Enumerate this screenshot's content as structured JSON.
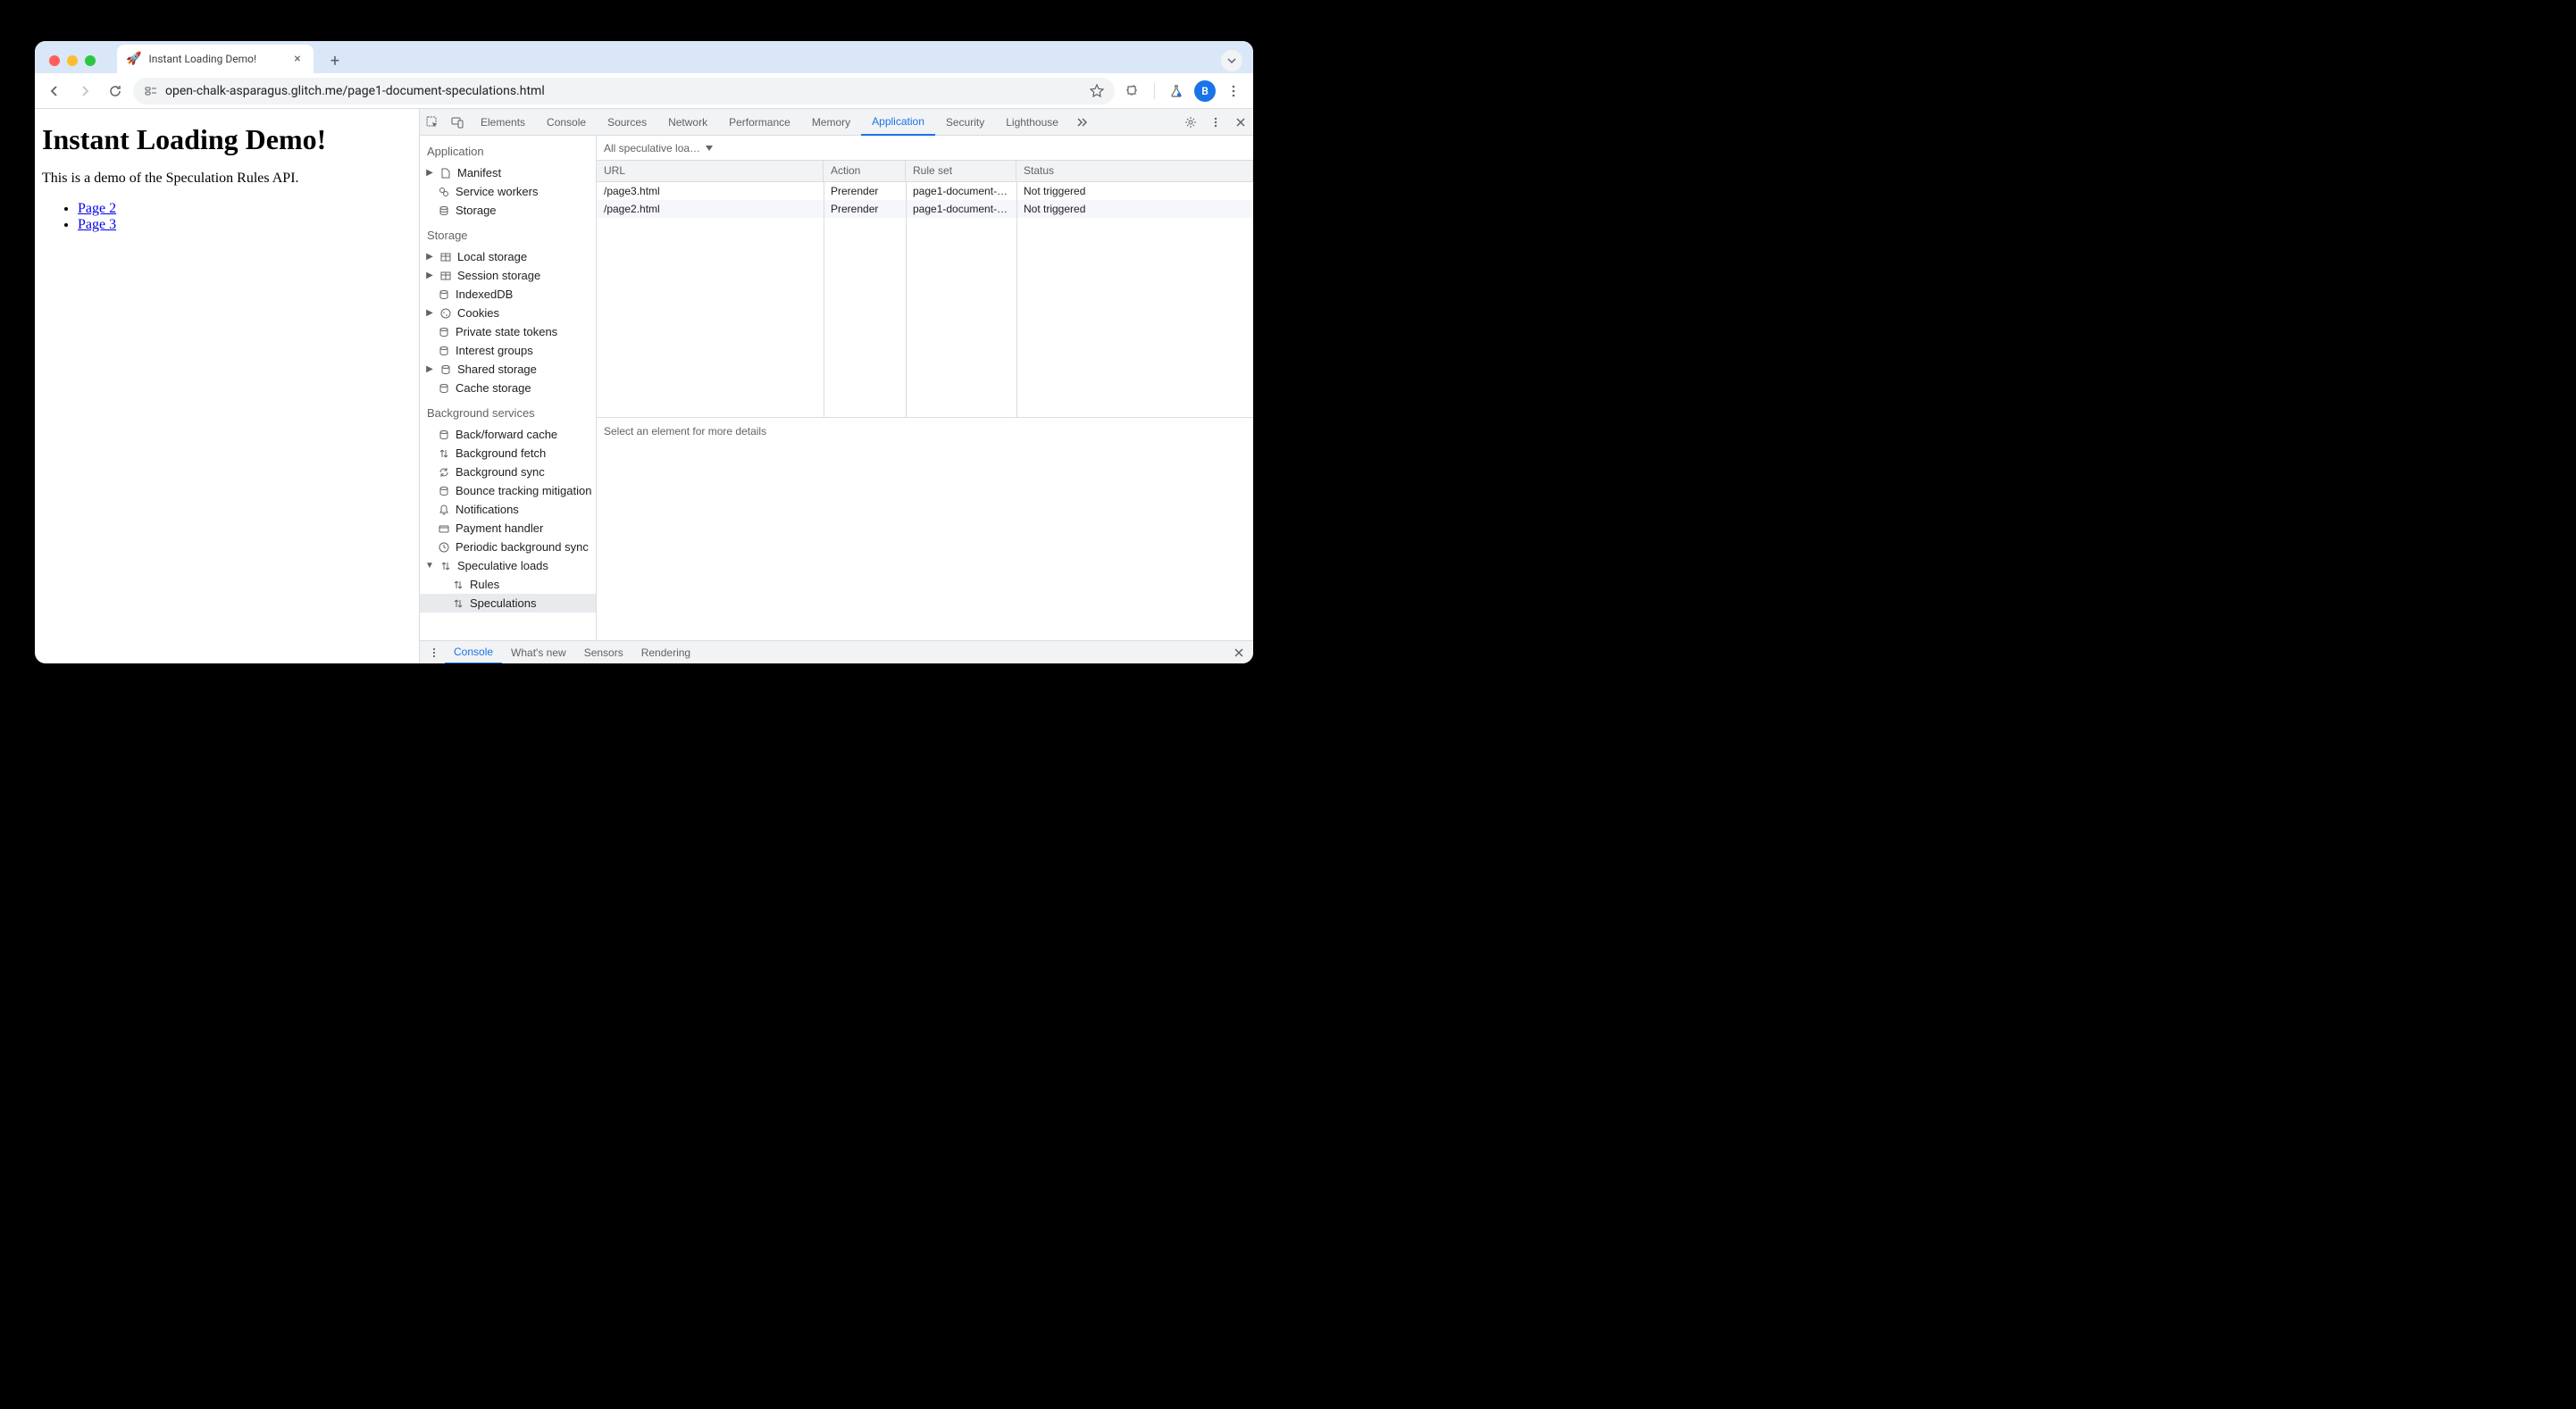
{
  "browser": {
    "tab": {
      "favicon": "🚀",
      "title": "Instant Loading Demo!"
    },
    "url": "open-chalk-asparagus.glitch.me/page1-document-speculations.html",
    "avatar_initial": "B"
  },
  "page": {
    "heading": "Instant Loading Demo!",
    "description": "This is a demo of the Speculation Rules API.",
    "links": [
      {
        "label": "Page 2"
      },
      {
        "label": "Page 3"
      }
    ]
  },
  "devtools": {
    "tabs": [
      "Elements",
      "Console",
      "Sources",
      "Network",
      "Performance",
      "Memory",
      "Application",
      "Security",
      "Lighthouse"
    ],
    "active_tab": "Application",
    "sidebar": {
      "sections": {
        "application": {
          "title": "Application",
          "items": [
            "Manifest",
            "Service workers",
            "Storage"
          ]
        },
        "storage": {
          "title": "Storage",
          "items": [
            "Local storage",
            "Session storage",
            "IndexedDB",
            "Cookies",
            "Private state tokens",
            "Interest groups",
            "Shared storage",
            "Cache storage"
          ]
        },
        "background": {
          "title": "Background services",
          "items": [
            "Back/forward cache",
            "Background fetch",
            "Background sync",
            "Bounce tracking mitigation",
            "Notifications",
            "Payment handler",
            "Periodic background sync",
            "Speculative loads"
          ],
          "speculative_children": [
            "Rules",
            "Speculations"
          ]
        }
      }
    },
    "filter_label": "All speculative loa…",
    "table": {
      "headers": {
        "url": "URL",
        "action": "Action",
        "ruleset": "Rule set",
        "status": "Status"
      },
      "rows": [
        {
          "url": "/page3.html",
          "action": "Prerender",
          "ruleset": "page1-document-…",
          "status": "Not triggered"
        },
        {
          "url": "/page2.html",
          "action": "Prerender",
          "ruleset": "page1-document-…",
          "status": "Not triggered"
        }
      ]
    },
    "detail_hint": "Select an element for more details",
    "drawer_tabs": [
      "Console",
      "What's new",
      "Sensors",
      "Rendering"
    ],
    "drawer_active": "Console"
  }
}
